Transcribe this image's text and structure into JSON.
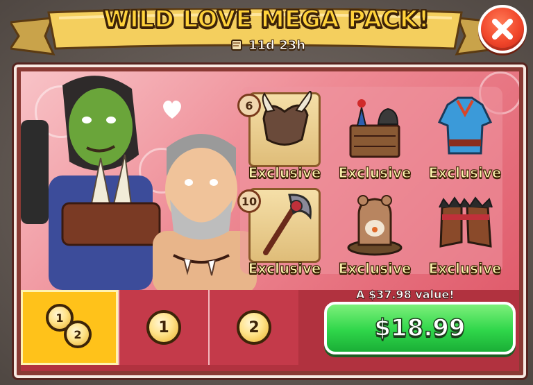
{
  "header": {
    "title": "WILD LOVE MEGA PACK!",
    "timer": "11d 23h"
  },
  "items": [
    {
      "name": "horned-helmet",
      "label": "Exclusive",
      "qty": "6"
    },
    {
      "name": "dresser-decor",
      "label": "Exclusive",
      "qty": ""
    },
    {
      "name": "blue-tunic",
      "label": "Exclusive",
      "qty": ""
    },
    {
      "name": "bone-axe",
      "label": "Exclusive",
      "qty": "10"
    },
    {
      "name": "bear-statue",
      "label": "Exclusive",
      "qty": ""
    },
    {
      "name": "fur-boots",
      "label": "Exclusive",
      "qty": ""
    }
  ],
  "options": {
    "combo": {
      "coin_a": "1",
      "coin_b": "2"
    },
    "single": "1",
    "double": "2"
  },
  "offer": {
    "value_text": "A $37.98 value!",
    "price": "$18.99"
  },
  "colors": {
    "title": "#ffd23a",
    "buy_button": "#2fd64a",
    "selected_option": "#ffc21a",
    "close_button": "#f0462a"
  }
}
